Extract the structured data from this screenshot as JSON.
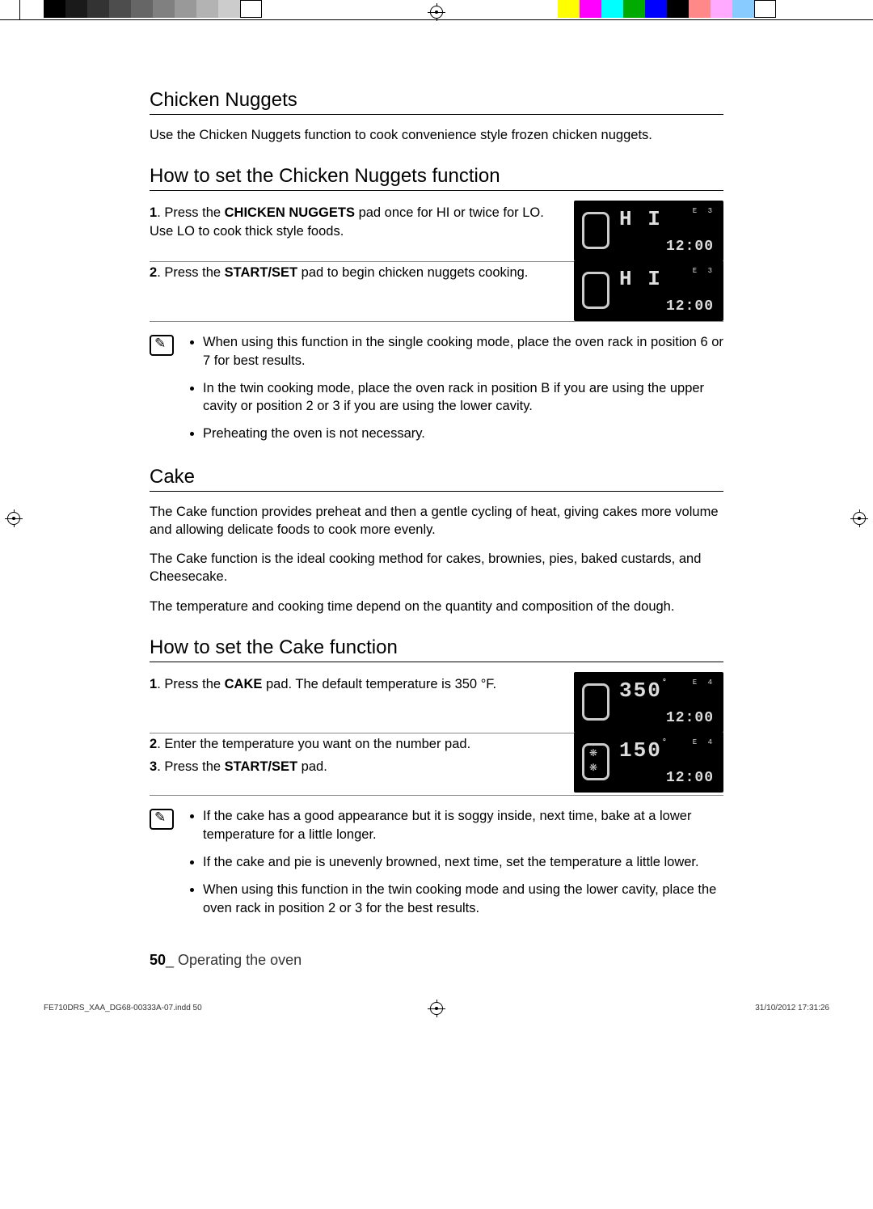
{
  "section1": {
    "title": "Chicken Nuggets",
    "intro": "Use the Chicken Nuggets function to cook convenience style frozen chicken nuggets."
  },
  "section2": {
    "title": "How to set the Chicken Nuggets function",
    "step1_num": "1",
    "step1_pre": ". Press the ",
    "step1_bold": "CHICKEN NUGGETS",
    "step1_post": " pad once for HI or twice for LO. Use LO to cook thick style foods.",
    "step2_num": "2",
    "step2_pre": ". Press the ",
    "step2_bold": "START/SET",
    "step2_post": " pad to begin chicken nuggets cooking.",
    "display1": {
      "main": "H I",
      "etag": "E  3",
      "clock": "12:00"
    },
    "display2": {
      "main": "H I",
      "etag": "E  3",
      "clock": "12:00"
    },
    "notes": [
      "When using this function in the single cooking mode, place the oven rack in position 6 or 7 for best results.",
      "In the twin cooking mode, place the oven rack in position B if you are using the upper cavity or position 2 or 3 if you are using the lower cavity.",
      "Preheating the oven is not necessary."
    ]
  },
  "section3": {
    "title": "Cake",
    "p1": "The Cake function provides preheat and then a gentle cycling of heat, giving cakes more volume and allowing delicate foods to cook more evenly.",
    "p2": "The Cake function is the ideal cooking method for cakes, brownies, pies, baked custards, and Cheesecake.",
    "p3": "The temperature and cooking time depend on the quantity and composition of the dough."
  },
  "section4": {
    "title": "How to set the Cake function",
    "step1_num": "1",
    "step1_pre": ". Press the ",
    "step1_bold": "CAKE",
    "step1_post": " pad. The default temperature is 350 °F.",
    "step2_num": "2",
    "step2_text": ". Enter the temperature you want on the number pad.",
    "step3_num": "3",
    "step3_pre": ". Press the ",
    "step3_bold": "START/SET",
    "step3_post": " pad.",
    "display1": {
      "main": "350",
      "deg": "°",
      "etag": "E  4",
      "clock": "12:00"
    },
    "display2": {
      "main": "150",
      "deg": "°",
      "etag": "E  4",
      "clock": "12:00"
    },
    "notes": [
      "If the cake has a good appearance but it is soggy inside, next time, bake at a lower temperature for a little longer.",
      "If the cake and pie is unevenly browned, next time, set the temperature a little lower.",
      "When using this function in the twin cooking mode and using the lower cavity, place the oven rack in position 2 or 3 for the best results."
    ]
  },
  "footer": {
    "page": "50",
    "sep": "_ ",
    "label": "Operating the oven"
  },
  "printfooter": {
    "left": "FE710DRS_XAA_DG68-00333A-07.indd   50",
    "right": "31/10/2012   17:31:26"
  }
}
